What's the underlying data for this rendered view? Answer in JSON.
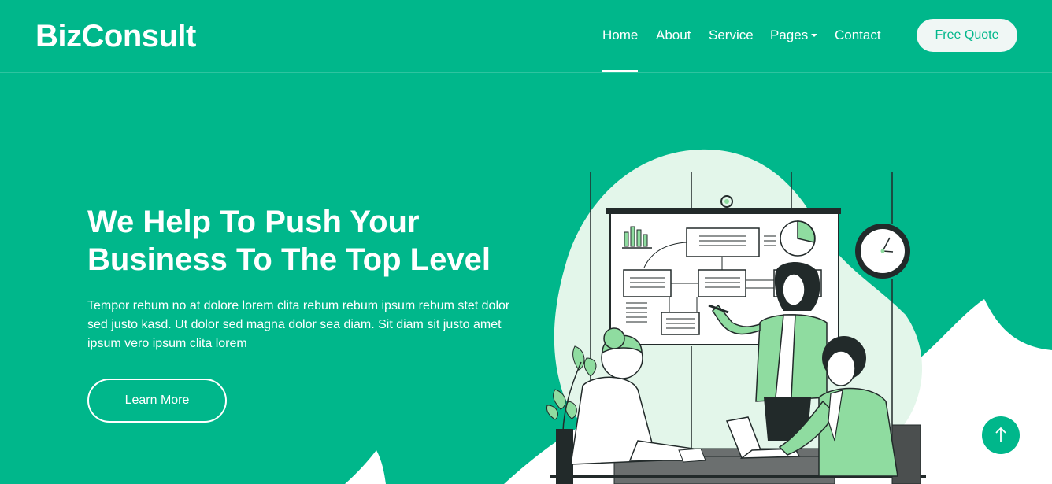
{
  "brand": {
    "name": "BizConsult"
  },
  "nav": {
    "items": [
      "Home",
      "About",
      "Service",
      "Pages",
      "Contact"
    ],
    "cta": "Free Quote"
  },
  "hero": {
    "title_line1": "We Help To Push Your",
    "title_line2": "Business To The Top Level",
    "text": "Tempor rebum no at dolore lorem clita rebum rebum ipsum rebum stet dolor sed justo kasd. Ut dolor sed magna dolor sea diam. Sit diam sit justo amet ipsum vero ipsum clita lorem",
    "button": "Learn More"
  },
  "colors": {
    "accent": "#00b78b",
    "light": "#e3f6ea",
    "figure_green": "#8fdca0",
    "dark": "#222a2a"
  },
  "icons": {
    "back_to_top": "arrow-up-icon",
    "pages_dropdown": "caret-down-icon"
  }
}
